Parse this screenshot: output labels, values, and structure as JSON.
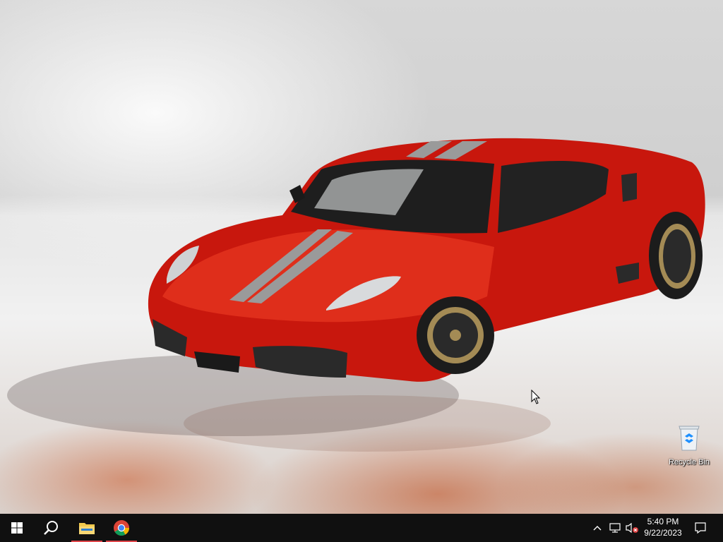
{
  "desktop": {
    "wallpaper": "red Ferrari sports car on white background with flames",
    "icons": [
      {
        "label": "Recycle Bin",
        "icon": "recycle-bin-icon"
      }
    ]
  },
  "taskbar": {
    "start": {
      "icon": "windows-logo-icon"
    },
    "search": {
      "icon": "search-icon"
    },
    "pinned": [
      {
        "name": "File Explorer",
        "icon": "folder-icon",
        "active": true
      },
      {
        "name": "Google Chrome",
        "icon": "chrome-icon",
        "active": true
      }
    ],
    "tray": {
      "icons": [
        "chevron-up-icon",
        "network-icon",
        "volume-muted-icon",
        "notifications-icon"
      ],
      "time": "5:40 PM",
      "date": "9/22/2023"
    },
    "accent_color": "#e0464b"
  }
}
